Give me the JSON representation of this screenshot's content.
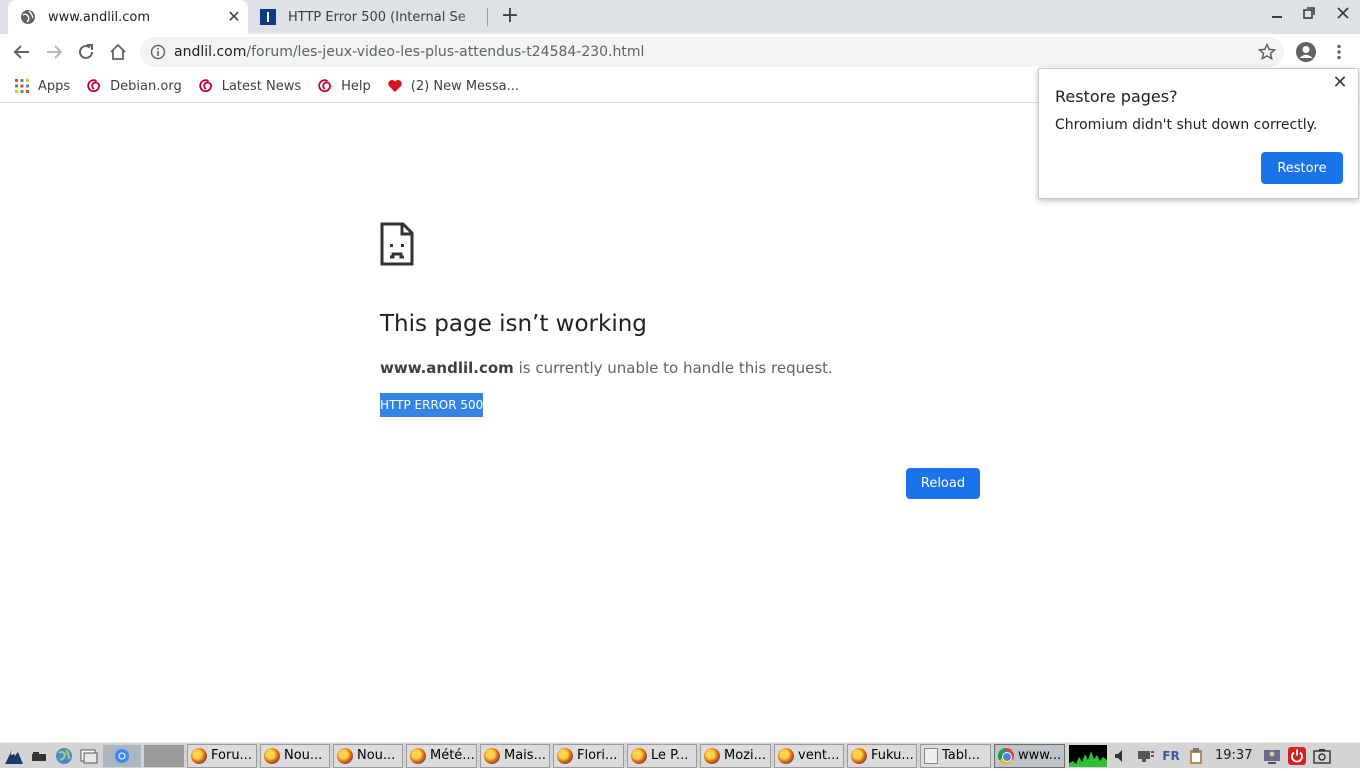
{
  "tabs": [
    {
      "title": "www.andlil.com",
      "active": true
    },
    {
      "title": "HTTP Error 500 (Internal Se",
      "active": false
    }
  ],
  "toolbar": {
    "url_host": "andlil.com",
    "url_path": "/forum/les-jeux-video-les-plus-attendus-t24584-230.html"
  },
  "bookmarks": [
    {
      "label": "Apps",
      "icon": "apps-grid-icon"
    },
    {
      "label": "Debian.org",
      "icon": "debian-swirl-icon"
    },
    {
      "label": "Latest News",
      "icon": "debian-swirl-icon"
    },
    {
      "label": "Help",
      "icon": "debian-swirl-icon"
    },
    {
      "label": "(2) New Messa...",
      "icon": "heart-icon"
    }
  ],
  "error_page": {
    "title": "This page isn’t working",
    "host": "www.andlil.com",
    "description": " is currently unable to handle this request.",
    "error_code": "HTTP ERROR 500",
    "reload_label": "Reload"
  },
  "restore_popup": {
    "title": "Restore pages?",
    "body": "Chromium didn't shut down correctly.",
    "button": "Restore"
  },
  "taskbar": {
    "tasks": [
      {
        "label": "Foru...",
        "icon": "firefox"
      },
      {
        "label": "Nou...",
        "icon": "firefox"
      },
      {
        "label": "Nou...",
        "icon": "firefox"
      },
      {
        "label": "Mété...",
        "icon": "firefox"
      },
      {
        "label": "Mais...",
        "icon": "firefox"
      },
      {
        "label": "Flori...",
        "icon": "firefox"
      },
      {
        "label": "Le P...",
        "icon": "firefox"
      },
      {
        "label": "Mozi...",
        "icon": "firefox"
      },
      {
        "label": "vent...",
        "icon": "firefox"
      },
      {
        "label": "Fuku...",
        "icon": "firefox"
      },
      {
        "label": "Tabl...",
        "icon": "document"
      },
      {
        "label": "www...",
        "icon": "chromium"
      }
    ],
    "keyboard_layout": "FR",
    "clock": "19:37"
  },
  "colors": {
    "accent": "#1a73e8",
    "selection": "#3584e4",
    "tabstrip": "#dee1e6"
  }
}
